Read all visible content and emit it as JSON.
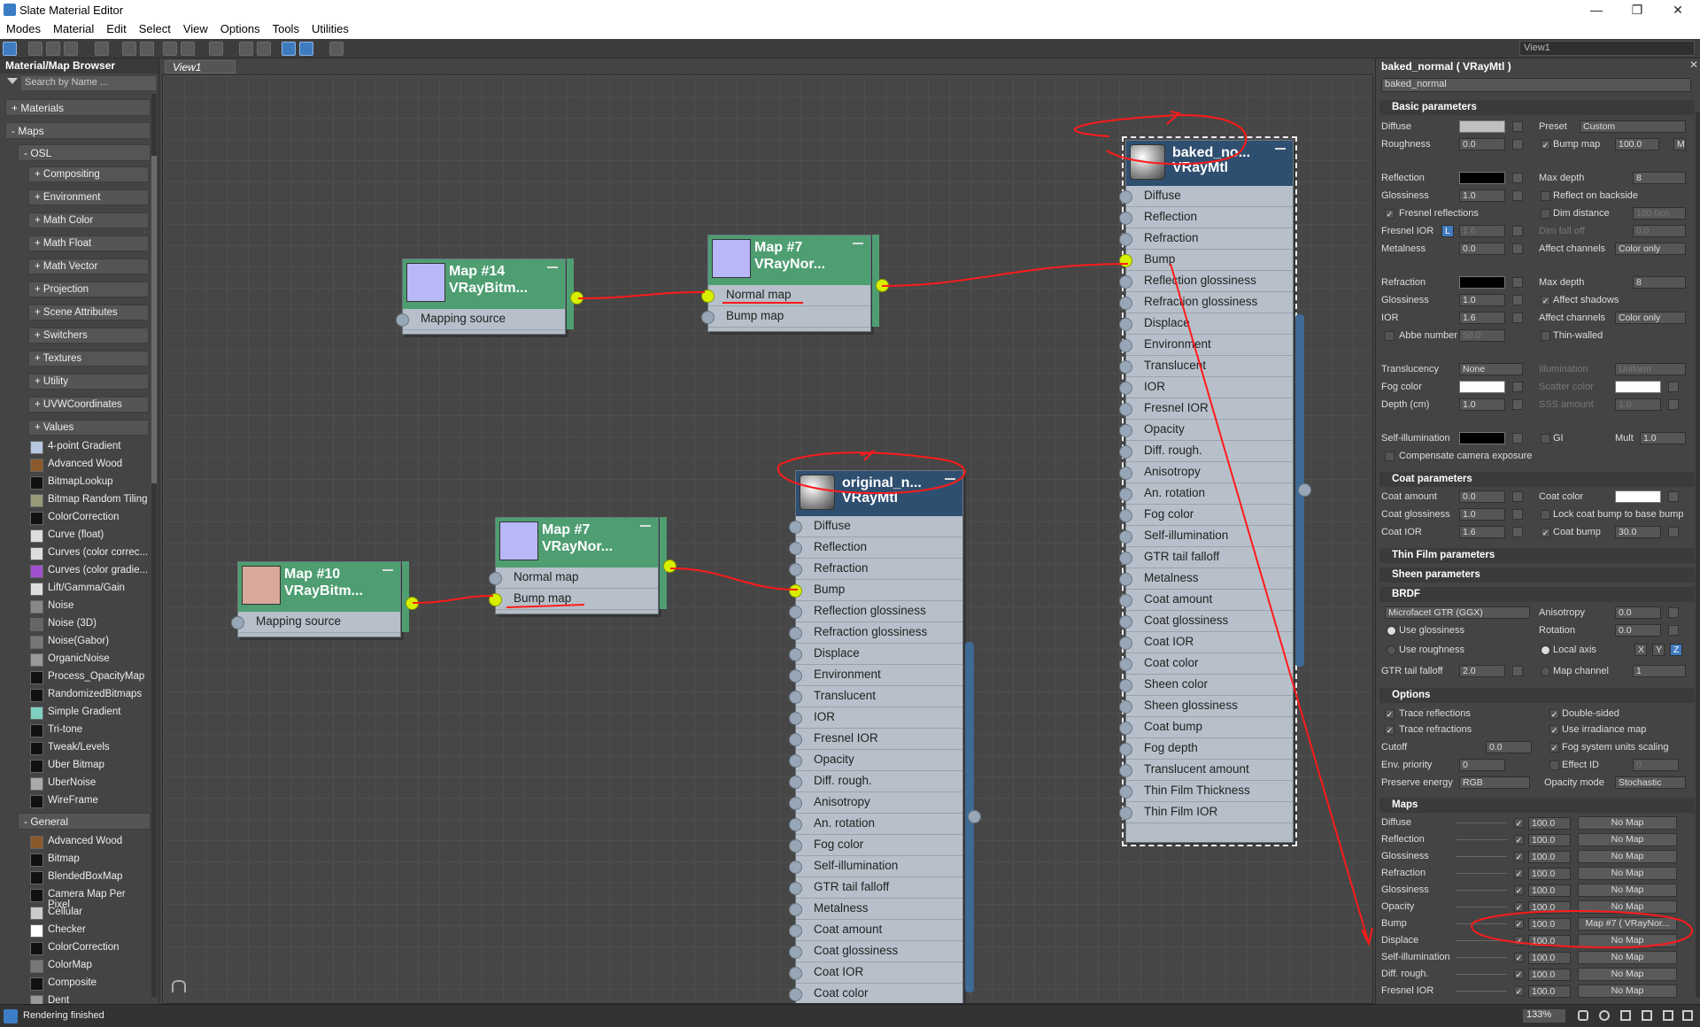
{
  "window": {
    "title": "Slate Material Editor",
    "min": "—",
    "max": "❐",
    "close": "✕"
  },
  "menu": [
    "Modes",
    "Material",
    "Edit",
    "Select",
    "View",
    "Options",
    "Tools",
    "Utilities"
  ],
  "toolbar": {
    "view_select": "View1"
  },
  "browser": {
    "title": "Material/Map Browser",
    "search_placeholder": "Search by Name ...",
    "sections": [
      "+ Materials",
      "- Maps",
      "- OSL"
    ],
    "osl_groups": [
      "+ Compositing",
      "+ Environment",
      "+ Math Color",
      "+ Math Float",
      "+ Math Vector",
      "+ Projection",
      "+ Scene Attributes",
      "+ Switchers",
      "+ Textures",
      "+ Utility",
      "+ UVWCoordinates",
      "+ Values"
    ],
    "osl_maps": [
      {
        "label": "4-point Gradient",
        "color": "#b7c8e0"
      },
      {
        "label": "Advanced Wood",
        "color": "#8a5a2b"
      },
      {
        "label": "BitmapLookup",
        "color": "#111111"
      },
      {
        "label": "Bitmap Random Tiling",
        "color": "#9a9a7a"
      },
      {
        "label": "ColorCorrection",
        "color": "#111111"
      },
      {
        "label": "Curve (float)",
        "color": "#dddddd"
      },
      {
        "label": "Curves (color correc...",
        "color": "#dddddd"
      },
      {
        "label": "Curves (color gradie...",
        "color": "#a050d0"
      },
      {
        "label": "Lift/Gamma/Gain",
        "color": "#dddddd"
      },
      {
        "label": "Noise",
        "color": "#888888"
      },
      {
        "label": "Noise (3D)",
        "color": "#666666"
      },
      {
        "label": "Noise(Gabor)",
        "color": "#777777"
      },
      {
        "label": "OrganicNoise",
        "color": "#999999"
      },
      {
        "label": "Process_OpacityMap",
        "color": "#111111"
      },
      {
        "label": "RandomizedBitmaps",
        "color": "#111111"
      },
      {
        "label": "Simple Gradient",
        "color": "#7fd0c0"
      },
      {
        "label": "Tri-tone",
        "color": "#111111"
      },
      {
        "label": "Tweak/Levels",
        "color": "#111111"
      },
      {
        "label": "Uber Bitmap",
        "color": "#111111"
      },
      {
        "label": "UberNoise",
        "color": "#aaaaaa"
      },
      {
        "label": "WireFrame",
        "color": "#111111"
      }
    ],
    "general_header": "- General",
    "general_maps": [
      {
        "label": "Advanced Wood",
        "color": "#8a5a2b"
      },
      {
        "label": "Bitmap",
        "color": "#111111"
      },
      {
        "label": "BlendedBoxMap",
        "color": "#111111"
      },
      {
        "label": "Camera Map Per Pixel",
        "color": "#111111"
      },
      {
        "label": "Cellular",
        "color": "#cccccc"
      },
      {
        "label": "Checker",
        "color": "#ffffff"
      },
      {
        "label": "ColorCorrection",
        "color": "#111111"
      },
      {
        "label": "ColorMap",
        "color": "#777777"
      },
      {
        "label": "Composite",
        "color": "#111111"
      },
      {
        "label": "Dent",
        "color": "#999999"
      }
    ]
  },
  "view": {
    "tab": "View1"
  },
  "nodes": {
    "map14": {
      "title": "Map #14",
      "subtitle": "VRayBitm...",
      "slots": [
        "Mapping source"
      ]
    },
    "map7a": {
      "title": "Map #7",
      "subtitle": "VRayNor...",
      "slots": [
        "Normal map",
        "Bump map"
      ]
    },
    "map10": {
      "title": "Map #10",
      "subtitle": "VRayBitm...",
      "slots": [
        "Mapping source"
      ]
    },
    "map7b": {
      "title": "Map #7",
      "subtitle": "VRayNor...",
      "slots": [
        "Normal map",
        "Bump map"
      ]
    },
    "baked": {
      "title": "baked_no...",
      "subtitle": "VRayMtl",
      "slots": [
        "Diffuse",
        "Reflection",
        "Refraction",
        "Bump",
        "Reflection glossiness",
        "Refraction glossiness",
        "Displace",
        "Environment",
        "Translucent",
        "IOR",
        "Fresnel IOR",
        "Opacity",
        "Diff. rough.",
        "Anisotropy",
        "An. rotation",
        "Fog color",
        "Self-illumination",
        "GTR tail falloff",
        "Metalness",
        "Coat amount",
        "Coat glossiness",
        "Coat IOR",
        "Coat color",
        "Sheen color",
        "Sheen glossiness",
        "Coat bump",
        "Fog depth",
        "Translucent amount",
        "Thin Film Thickness",
        "Thin Film IOR"
      ]
    },
    "original": {
      "title": "original_n...",
      "subtitle": "VRayMtl",
      "slots": [
        "Diffuse",
        "Reflection",
        "Refraction",
        "Bump",
        "Reflection glossiness",
        "Refraction glossiness",
        "Displace",
        "Environment",
        "Translucent",
        "IOR",
        "Fresnel IOR",
        "Opacity",
        "Diff. rough.",
        "Anisotropy",
        "An. rotation",
        "Fog color",
        "Self-illumination",
        "GTR tail falloff",
        "Metalness",
        "Coat amount",
        "Coat glossiness",
        "Coat IOR",
        "Coat color"
      ]
    }
  },
  "panel": {
    "title": "baked_normal  ( VRayMtl )",
    "name_value": "baked_normal",
    "basic": {
      "header": "Basic parameters",
      "diffuse": "Diffuse",
      "preset": "Preset",
      "preset_val": "Custom",
      "roughness": "Roughness",
      "roughness_val": "0.0",
      "bump_map": "Bump map",
      "bump_val": "100.0",
      "m": "M",
      "reflection": "Reflection",
      "max_depth": "Max depth",
      "max_depth_val": "8",
      "glossiness": "Glossiness",
      "glossiness_val": "1.0",
      "reflect_backside": "Reflect on backside",
      "fresnel": "Fresnel reflections",
      "dim_distance": "Dim distance",
      "dim_distance_val": "100.0cn",
      "fresnel_ior": "Fresnel IOR",
      "l": "L",
      "fresnel_ior_val": "1.6",
      "dim_falloff": "Dim fall off",
      "dim_falloff_val": "0.0",
      "metalness": "Metalness",
      "metalness_val": "0.0",
      "affect_channels": "Affect channels",
      "affect_val": "Color only",
      "refraction": "Refraction",
      "rmax_depth_val": "8",
      "rglossiness_val": "1.0",
      "affect_shadows": "Affect shadows",
      "ior": "IOR",
      "ior_val": "1.6",
      "raffect_val": "Color only",
      "abbe": "Abbe number",
      "abbe_val": "50.0",
      "thin_walled": "Thin-walled",
      "translucency": "Translucency",
      "translucency_val": "None",
      "illumination": "Illumination",
      "illumination_val": "Uniform",
      "fog_color": "Fog color",
      "scatter_color": "Scatter color",
      "depth": "Depth (cm)",
      "depth_val": "1.0",
      "sss": "SSS amount",
      "sss_val": "1.0",
      "self_illum": "Self-illumination",
      "gi": "GI",
      "mult": "Mult",
      "mult_val": "1.0",
      "comp_cam": "Compensate camera exposure"
    },
    "coat": {
      "header": "Coat parameters",
      "amount": "Coat amount",
      "amount_val": "0.0",
      "color": "Coat color",
      "gloss": "Coat glossiness",
      "gloss_val": "1.0",
      "lock": "Lock coat bump to base bump",
      "ior": "Coat IOR",
      "ior_val": "1.6",
      "bump": "Coat bump",
      "bump_val": "30.0"
    },
    "thin_film": "Thin Film parameters",
    "sheen": "Sheen parameters",
    "brdf": {
      "header": "BRDF",
      "type": "Microfacet GTR (GGX)",
      "anisotropy": "Anisotropy",
      "anisotropy_val": "0.0",
      "use_gloss": "Use glossiness",
      "rotation": "Rotation",
      "rotation_val": "0.0",
      "use_rough": "Use roughness",
      "local_axis": "Local axis",
      "x": "X",
      "y": "Y",
      "z": "Z",
      "gtr": "GTR tail falloff",
      "gtr_val": "2.0",
      "map_channel": "Map channel",
      "map_channel_val": "1"
    },
    "options": {
      "header": "Options",
      "trace_refl": "Trace reflections",
      "double_sided": "Double-sided",
      "trace_refr": "Trace refractions",
      "use_irr": "Use irradiance map",
      "cutoff": "Cutoff",
      "cutoff_val": "0.0",
      "fog_units": "Fog system units scaling",
      "env_priority": "Env. priority",
      "env_priority_val": "0",
      "effect_id": "Effect ID",
      "effect_id_val": "0",
      "preserve": "Preserve energy",
      "preserve_val": "RGB",
      "opacity_mode": "Opacity mode",
      "opacity_mode_val": "Stochastic"
    },
    "maps": {
      "header": "Maps",
      "rows": [
        {
          "label": "Diffuse",
          "val": "100.0",
          "map": "No Map"
        },
        {
          "label": "Reflection",
          "val": "100.0",
          "map": "No Map"
        },
        {
          "label": "Glossiness",
          "val": "100.0",
          "map": "No Map"
        },
        {
          "label": "Refraction",
          "val": "100.0",
          "map": "No Map"
        },
        {
          "label": "Glossiness",
          "val": "100.0",
          "map": "No Map"
        },
        {
          "label": "Opacity",
          "val": "100.0",
          "map": "No Map"
        },
        {
          "label": "Bump",
          "val": "100.0",
          "map": "Map #7  ( VRayNor..."
        },
        {
          "label": "Displace",
          "val": "100.0",
          "map": "No Map"
        },
        {
          "label": "Self-illumination",
          "val": "100.0",
          "map": "No Map"
        },
        {
          "label": "Diff. rough.",
          "val": "100.0",
          "map": "No Map"
        },
        {
          "label": "Fresnel IOR",
          "val": "100.0",
          "map": "No Map"
        }
      ]
    }
  },
  "status": {
    "text": "Rendering finished",
    "zoom": "133%"
  },
  "colors": {
    "map_header": "#4e9e72",
    "mtl_header": "#2f4f70",
    "socket_active": "#d8f000",
    "wire": "#ff1a1a",
    "annotation": "#ff1a1a"
  }
}
